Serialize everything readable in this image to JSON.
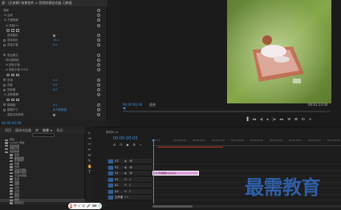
{
  "effect_controls": {
    "title": "源：(无剪辑)  效果控件 ≡  音频剪辑混合器  元数据",
    "timecode": "00:00:00:00",
    "rows": [
      {
        "label": "视频",
        "indent": 2,
        "kind": "header"
      },
      {
        "label": "fx 运动",
        "indent": 3,
        "kind": "fx"
      },
      {
        "label": "fx 不透明度",
        "indent": 3,
        "kind": "fx"
      },
      {
        "label": "fx 蒙版(1)",
        "indent": 5,
        "kind": "fx"
      },
      {
        "label": "",
        "indent": 8,
        "kind": "shapes"
      },
      {
        "label": "蒙版路径",
        "indent": 7,
        "kind": "check"
      },
      {
        "label": "蒙版羽化",
        "indent": 7,
        "kind": "value",
        "value": "10.0"
      },
      {
        "label": "蒙版扩展",
        "indent": 7,
        "kind": "value",
        "value": "0.0"
      },
      {
        "label": "",
        "indent": 8,
        "kind": "blank"
      },
      {
        "label": "混合模式",
        "indent": 7,
        "kind": "value",
        "value": ""
      },
      {
        "label": "时间重映射",
        "indent": 5,
        "kind": "fx"
      },
      {
        "label": "fx 颜色平衡",
        "indent": 5,
        "kind": "fx"
      },
      {
        "label": "fx 颜色平衡 (HLS)",
        "indent": 5,
        "kind": "fx"
      },
      {
        "label": "",
        "indent": 8,
        "kind": "shapes"
      },
      {
        "label": "色相",
        "indent": 7,
        "kind": "value",
        "value": "0.0"
      },
      {
        "label": "亮度",
        "indent": 7,
        "kind": "value",
        "value": "0.0"
      },
      {
        "label": "饱和度",
        "indent": 7,
        "kind": "value",
        "value": "0.0"
      },
      {
        "label": "fx 高斯模糊",
        "indent": 3,
        "kind": "fx"
      },
      {
        "label": "",
        "indent": 8,
        "kind": "shapes"
      },
      {
        "label": "模糊度",
        "indent": 7,
        "kind": "value",
        "value": "0.0"
      },
      {
        "label": "模糊尺寸",
        "indent": 7,
        "kind": "value",
        "value": "水平和垂直"
      },
      {
        "label": "重复边缘像素",
        "indent": 7,
        "kind": "check"
      }
    ]
  },
  "monitor": {
    "timecode_left": "00:00:00:00",
    "fit": "适合",
    "timecode_right": "00:01:13:00",
    "controls": [
      "▐",
      "◂◂",
      "◂|",
      "▸",
      "|▸",
      "▸▸",
      "⊟",
      "⊞",
      "⊡",
      "+"
    ]
  },
  "project": {
    "tabs": [
      "项目",
      "媒体浏览器",
      "库",
      "效果 ≡",
      "标记"
    ],
    "active_tab": 3,
    "tree": [
      {
        "label": "预设",
        "indent": 4,
        "arrow": true
      },
      {
        "label": "Lumetri 预设",
        "indent": 4,
        "arrow": true
      },
      {
        "label": "音频效果",
        "indent": 4,
        "arrow": true
      },
      {
        "label": "音频过渡",
        "indent": 4,
        "arrow": true
      },
      {
        "label": "视频效果",
        "indent": 4,
        "arrow": true
      },
      {
        "label": "变换",
        "indent": 10,
        "arrow": false
      },
      {
        "label": "图像控制",
        "indent": 10,
        "arrow": false
      },
      {
        "label": "实用程序",
        "indent": 10,
        "arrow": false
      },
      {
        "label": "扭曲",
        "indent": 10,
        "arrow": false
      },
      {
        "label": "时间",
        "indent": 10,
        "arrow": false
      },
      {
        "label": "杂色与颗粒",
        "indent": 10,
        "arrow": false
      },
      {
        "label": "模糊与锐化",
        "indent": 10,
        "arrow": false
      },
      {
        "label": "沉浸式视频",
        "indent": 10,
        "arrow": false
      },
      {
        "label": "生成",
        "indent": 10,
        "arrow": false
      },
      {
        "label": "视频",
        "indent": 10,
        "arrow": false
      },
      {
        "label": "调整",
        "indent": 10,
        "arrow": false
      },
      {
        "label": "过时",
        "indent": 10,
        "arrow": false
      },
      {
        "label": "过渡",
        "indent": 10,
        "arrow": false
      },
      {
        "label": "透视",
        "indent": 10,
        "arrow": false
      },
      {
        "label": "通道",
        "indent": 10,
        "arrow": false
      },
      {
        "label": "键控",
        "indent": 10,
        "arrow": false,
        "selected": true
      },
      {
        "label": "颜色校正",
        "indent": 10,
        "arrow": false
      }
    ]
  },
  "tools": [
    "▸",
    "⇥",
    "⇿",
    "✂",
    "⇔",
    "✎",
    "✋",
    "T"
  ],
  "timeline": {
    "tab": "序列01 ≡",
    "timecode": "00:00:00:00",
    "icons": [
      "⎌",
      "⊓",
      "◆",
      "⚙",
      "⌁"
    ],
    "ticks": [
      "00:00",
      "00:00:05:00",
      "00:00:10:00",
      "00:00:15:00",
      "00:00:20:00",
      "00:00:25:00",
      "00:00:30:00",
      "00:00:35:00",
      "00:00:40:00",
      "00:00:45:00"
    ],
    "tracks": [
      {
        "name": "V3",
        "i1": "◉",
        "i2": "👁"
      },
      {
        "name": "V2",
        "i1": "◉",
        "i2": "👁"
      },
      {
        "name": "V1",
        "i1": "◉",
        "i2": "👁"
      },
      {
        "name": "A1",
        "i1": "M",
        "i2": "S"
      },
      {
        "name": "A2",
        "i1": "M",
        "i2": "S"
      },
      {
        "name": "A3",
        "i1": "M",
        "i2": "S"
      },
      {
        "name": "主声道",
        "i1": "0.0",
        "i2": ""
      }
    ],
    "clip_label": "fx 草地野餐.mp4 [V]"
  },
  "watermark": "最需教育",
  "ime": {
    "badge": "S",
    "glyphs": [
      "中",
      "♪",
      "☺",
      "🎤",
      "⌨",
      "👕",
      "⊞"
    ]
  },
  "colors": {
    "accent": "#3f8fd8",
    "clip": "#d79fd8",
    "workarea": "#c0392b",
    "watermark": "#2f5fa8"
  }
}
